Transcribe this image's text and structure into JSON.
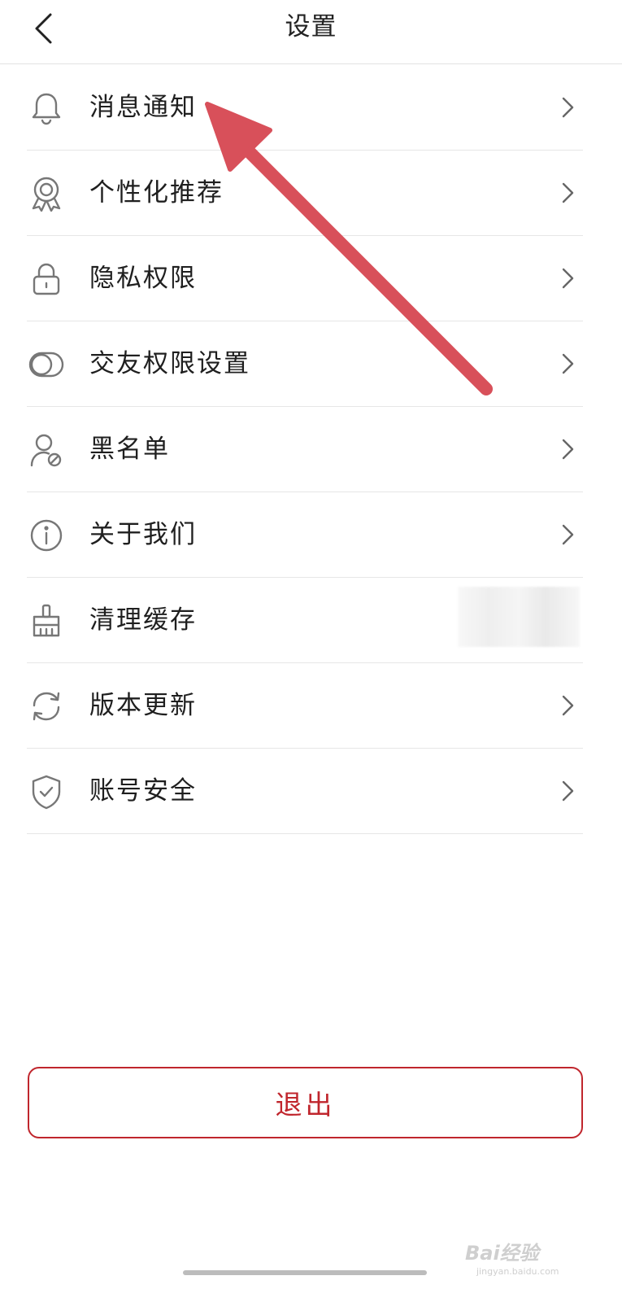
{
  "header": {
    "title": "设置"
  },
  "settings": {
    "items": [
      {
        "label": "消息通知",
        "icon": "bell-icon"
      },
      {
        "label": "个性化推荐",
        "icon": "badge-icon"
      },
      {
        "label": "隐私权限",
        "icon": "lock-icon"
      },
      {
        "label": "交友权限设置",
        "icon": "toggle-circles-icon"
      },
      {
        "label": "黑名单",
        "icon": "user-block-icon"
      },
      {
        "label": "关于我们",
        "icon": "info-icon"
      },
      {
        "label": "清理缓存",
        "icon": "broom-icon"
      },
      {
        "label": "版本更新",
        "icon": "refresh-icon"
      },
      {
        "label": "账号安全",
        "icon": "shield-check-icon"
      }
    ]
  },
  "logout": {
    "label": "退出"
  },
  "watermark": {
    "text": "Bai经验",
    "sub": "jingyan.baidu.com"
  },
  "colors": {
    "accent": "#c0262d",
    "arrow": "#d8505a",
    "icon": "#777777",
    "divider": "#e6e6e6"
  }
}
